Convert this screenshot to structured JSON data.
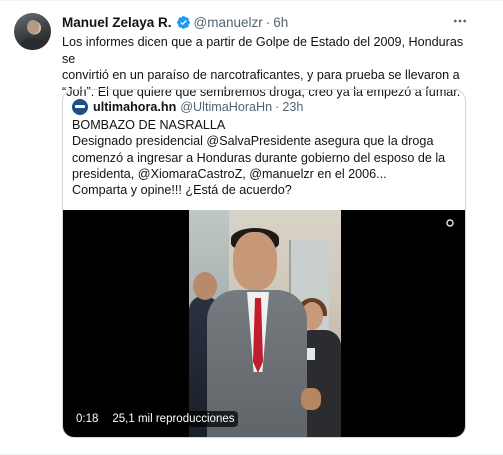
{
  "tweet": {
    "display_name": "Manuel Zelaya R.",
    "handle": "@manuelzr",
    "separator": "·",
    "time": "6h",
    "text_lines": [
      "Los informes dicen que a partir de Golpe de Estado del 2009, Honduras se",
      "convirtió en un  paraíso de narcotraficantes, y para prueba  se llevaron a",
      "“Joh”. El que quiere que sembremos droga, creo ya la empezó a fumar."
    ]
  },
  "quoted": {
    "display_name": "ultimahora.hn",
    "handle": "@UltimaHoraHn",
    "separator": "·",
    "time": "23h",
    "text_lines": [
      "BOMBAZO DE NASRALLA",
      "Designado presidencial @SalvaPresidente asegura que la droga",
      "comenzó a ingresar a Honduras durante gobierno del esposo de la",
      "presidenta, @XiomaraCastroZ, @manuelzr en el 2006...",
      "Comparta y opine!!! ¿Está de acuerdo?"
    ],
    "video": {
      "duration": "0:18",
      "views": "25,1 mil reproducciones"
    }
  },
  "colors": {
    "verified_blue": "#1d9bf0",
    "text_primary": "#0f1419",
    "text_secondary": "#536471",
    "border": "#cfd9de"
  },
  "icons": {
    "verified": "verified-badge-icon",
    "more": "more-options-icon",
    "gif": "gif-indicator-icon"
  }
}
